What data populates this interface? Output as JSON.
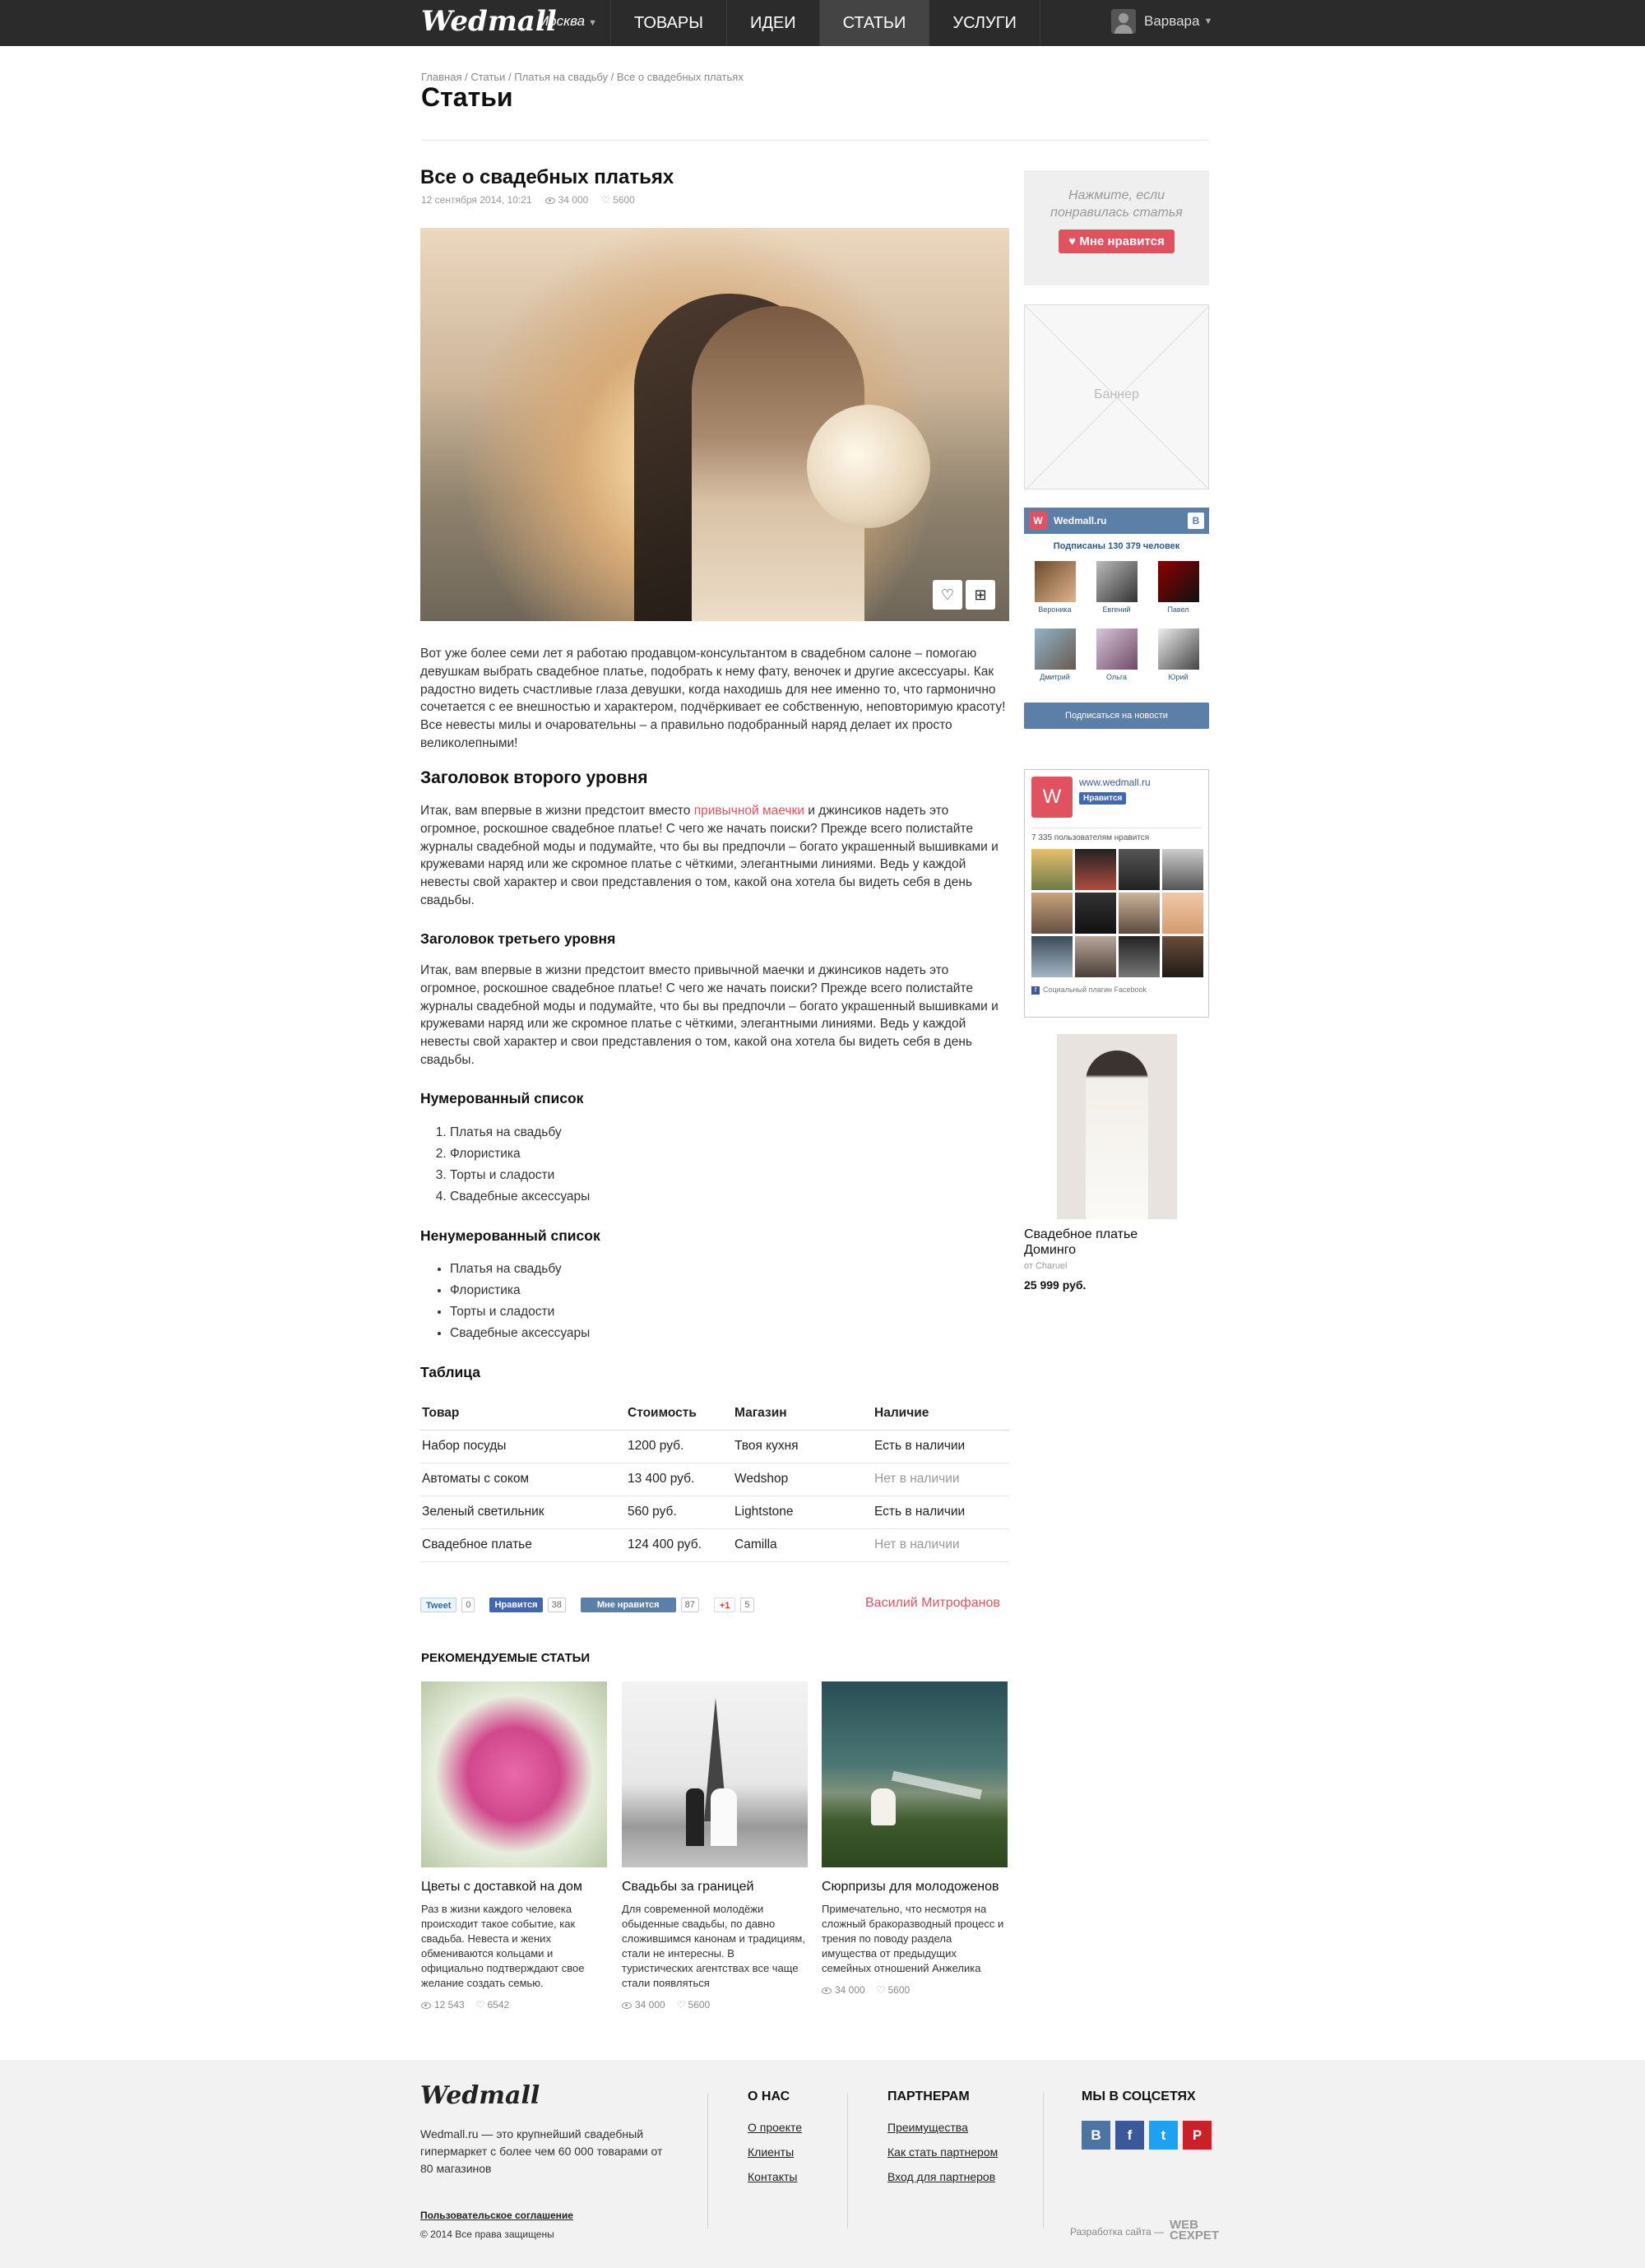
{
  "header": {
    "logo": "Wedmall",
    "city": "Москва",
    "nav": [
      "ТОВАРЫ",
      "ИДЕИ",
      "СТАТЬИ",
      "УСЛУГИ"
    ],
    "user": "Варвара"
  },
  "breadcrumb": "Главная / Статьи / Платья на свадьбу / Все о свадебных платьях",
  "page_title": "Статьи",
  "article": {
    "title": "Все о свадебных платьях",
    "date": "12 сентября 2014, 10:21",
    "views": "34 000",
    "likes": "5600",
    "intro": "Вот уже более семи лет я работаю продавцом-консультантом в свадебном салоне – помогаю девушкам выбрать свадебное платье, подобрать к нему фату, веночек и другие аксессуары. Как радостно видеть счастливые глаза девушки, когда находишь для нее именно то, что гармонично сочетается с ее внешностью и характером, подчёркивает ее собственную, неповторимую красоту! Все невесты милы и очаровательны – а правильно подобранный наряд делает их просто великолепными!",
    "h2": "Заголовок второго уровня",
    "p2_before": "Итак, вам впервые в жизни предстоит вместо ",
    "p2_link": "привычной маечки",
    "p2_after": " и джинсиков надеть это огромное, роскошное свадебное платье! С чего же начать поиски? Прежде всего полистайте журналы свадебной моды и подумайте, что бы вы предпочли – богато украшенный вышивками и кружевами наряд или же скромное платье с чёткими, элегантными линиями. Ведь у каждой невесты свой характер и свои представления о том, какой она хотела бы видеть себя в день свадьбы.",
    "h3": "Заголовок третьего уровня",
    "p3": "Итак, вам впервые в жизни предстоит вместо привычной маечки и джинсиков надеть это огромное, роскошное свадебное платье! С чего же начать поиски? Прежде всего полистайте журналы свадебной моды и подумайте, что бы вы предпочли – богато украшенный вышивками и кружевами наряд или же скромное платье с чёткими, элегантными линиями. Ведь у каждой невесты свой характер и свои представления о том, какой она хотела бы видеть себя в день свадьбы.",
    "ol_title": "Нумерованный список",
    "ol": [
      "Платья на свадьбу",
      "Флористика",
      "Торты и сладости",
      "Свадебные аксессуары"
    ],
    "ul_title": "Ненумерованный список",
    "ul": [
      "Платья на свадьбу",
      "Флористика",
      "Торты и сладости",
      "Свадебные аксессуары"
    ],
    "table_title": "Таблица",
    "table_headers": [
      "Товар",
      "Стоимость",
      "Магазин",
      "Наличие"
    ],
    "table_rows": [
      [
        "Набор посуды",
        "1200 руб.",
        "Твоя кухня",
        "Есть в наличии"
      ],
      [
        "Автоматы с соком",
        "13 400 руб.",
        "Wedshop",
        "Нет в наличии"
      ],
      [
        "Зеленый светильник",
        "560 руб.",
        "Lightstone",
        "Есть в наличии"
      ],
      [
        "Свадебное платье",
        "124 400 руб.",
        "Camilla",
        "Нет в наличии"
      ]
    ],
    "author": "Василий Митрофанов"
  },
  "share": {
    "tweet": "Tweet",
    "tweet_count": "0",
    "fb": "Нравится",
    "fb_count": "38",
    "vk": "Мне нравится",
    "vk_count": "87",
    "gplus": "+1",
    "gplus_count": "5"
  },
  "recommended": {
    "title": "РЕКОМЕНДУЕМЫЕ СТАТЬИ",
    "cards": [
      {
        "title": "Цветы с доставкой на дом",
        "desc": "Раз в жизни каждого человека происходит такое событие, как свадьба. Невеста и жених обмениваются кольцами и официально подтверждают свое желание создать семью.",
        "views": "12 543",
        "likes": "6542"
      },
      {
        "title": "Свадьбы за границей",
        "desc": "Для современной молодёжи обыденные свадьбы, по давно сложившимся канонам и традициям, стали не интересны. В туристических агентствах все чаще стали появляться",
        "views": "34 000",
        "likes": "5600"
      },
      {
        "title": "Сюрпризы для молодоженов",
        "desc": "Примечательно, что несмотря на сложный бракоразводный процесс и трения по поводу раздела имущества от предыдущих семейных отношений Анжелика",
        "views": "34 000",
        "likes": "5600"
      }
    ]
  },
  "sidebar": {
    "like_prompt": "Нажмите, если понравилась статья",
    "like_button": "Мне нравится",
    "banner": "Баннер",
    "vk": {
      "name": "Wedmall.ru",
      "subscribers": "Подписаны 130 379 человек",
      "people": [
        "Вероника",
        "Евгений",
        "Павел",
        "Дмитрий",
        "Ольга",
        "Юрий"
      ],
      "button": "Подписаться на новости"
    },
    "fb": {
      "url": "www.wedmall.ru",
      "like": "Нравится",
      "count": "7 335 пользователям нравится",
      "footer": "Социальный плагин Facebook"
    },
    "product": {
      "name": "Свадебное платье Доминго",
      "by": "от Charuel",
      "price": "25 999 руб."
    }
  },
  "footer": {
    "logo": "Wedmall",
    "desc": "Wedmall.ru — это крупнейший свадебный гипермаркет с более чем 60 000 товарами от 80 магазинов",
    "agreement": "Пользовательское соглашение",
    "copyright": "© 2014 Все права защищены",
    "about_title": "О НАС",
    "about": [
      "О проекте",
      "Клиенты",
      "Контакты"
    ],
    "partners_title": "ПАРТНЕРАМ",
    "partners": [
      "Преимущества",
      "Как стать партнером",
      "Вход для партнеров"
    ],
    "social_title": "МЫ В СОЦСЕТЯХ",
    "dev": "Разработка сайта —",
    "dev_logo": "WEB СЕХРЕТ"
  },
  "colors": {
    "accent": "#e05260",
    "header": "#2b2b2b",
    "vk": "#5b7fa6",
    "footer_bg": "#f2f2f2"
  }
}
